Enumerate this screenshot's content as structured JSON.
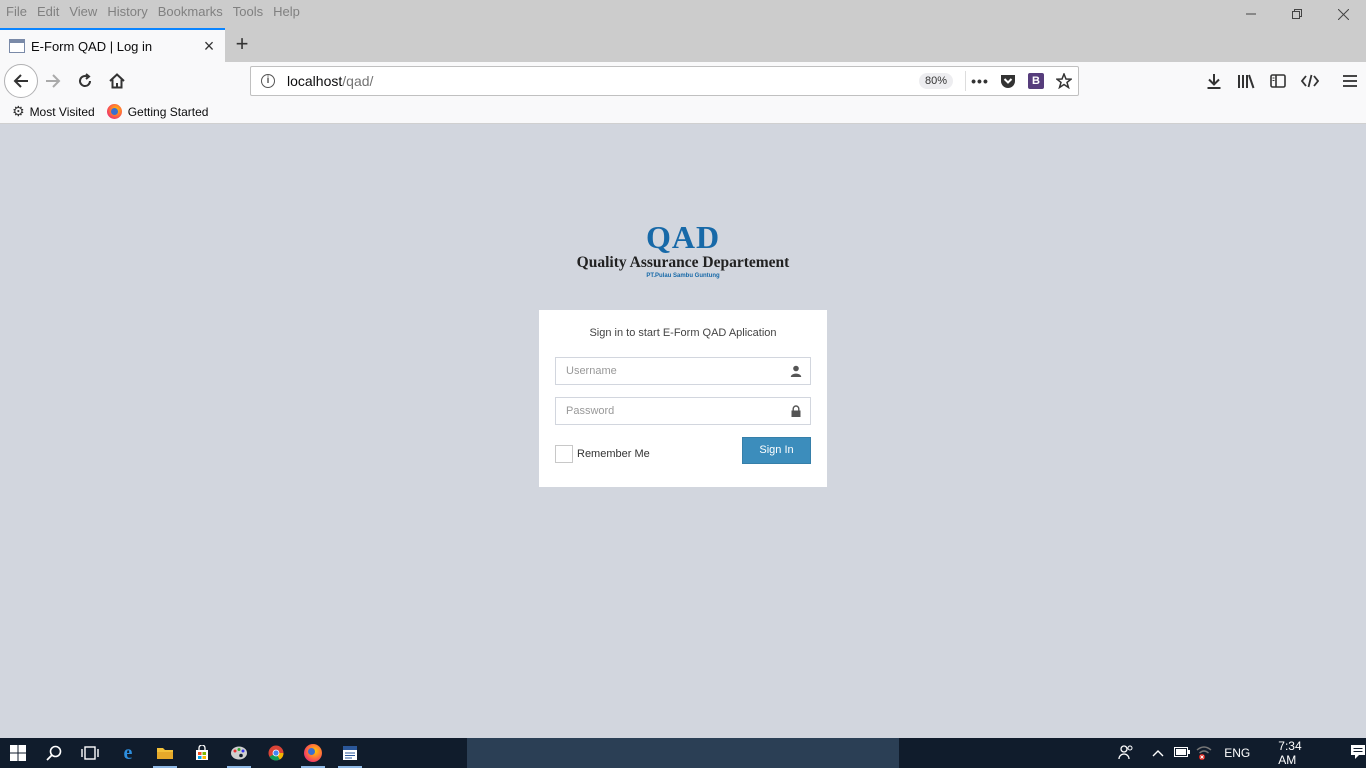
{
  "menu": [
    "File",
    "Edit",
    "View",
    "History",
    "Bookmarks",
    "Tools",
    "Help"
  ],
  "tab": {
    "title": "E-Form QAD | Log in"
  },
  "url": {
    "host": "localhost",
    "path": "/qad/",
    "zoom": "80%"
  },
  "bookmarks": {
    "most_visited": "Most Visited",
    "getting_started": "Getting Started"
  },
  "logo": {
    "big": "QAD",
    "dept": "Quality Assurance Departement",
    "company": "PT.Pulau Sambu Guntung"
  },
  "login": {
    "message": "Sign in to start E-Form QAD Aplication",
    "username_placeholder": "Username",
    "password_placeholder": "Password",
    "remember_label": "Remember Me",
    "signin_label": "Sign In"
  },
  "taskbar": {
    "language": "ENG",
    "time": "7:34 AM"
  },
  "bootstrap_badge": "B",
  "colors": {
    "accent": "#3c8dbc",
    "background": "#d2d6de",
    "logo_blue": "#1769a8",
    "taskbar": "#101c2c"
  }
}
